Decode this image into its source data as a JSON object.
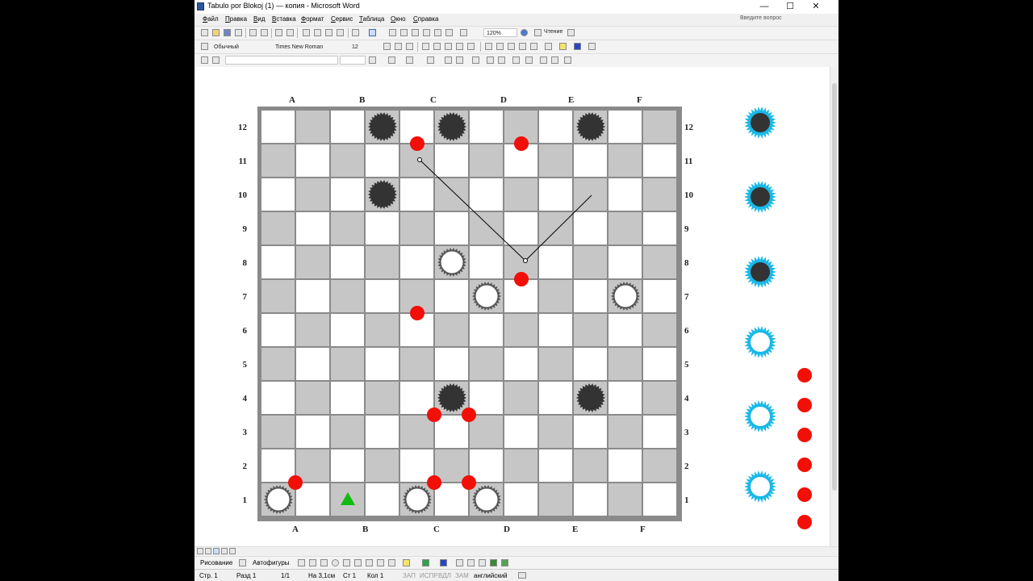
{
  "window": {
    "title": "Tabulo por Blokoj (1) — копия - Microsoft Word",
    "controls": {
      "minimize": "—",
      "maximize": "☐",
      "close": "✕"
    }
  },
  "menu": {
    "items": [
      "Файл",
      "Правка",
      "Вид",
      "Вставка",
      "Формат",
      "Сервис",
      "Таблица",
      "Окно",
      "Справка"
    ],
    "help_placeholder": "Введите вопрос"
  },
  "toolbar": {
    "zoom": "120%",
    "reading_label": "Чтение",
    "style": "Обычный",
    "font": "Times New Roman",
    "font_size": "12"
  },
  "board": {
    "columns": [
      "A",
      "B",
      "C",
      "D",
      "E",
      "F"
    ],
    "rows": [
      "12",
      "11",
      "10",
      "9",
      "8",
      "7",
      "6",
      "5",
      "4",
      "3",
      "2",
      "1"
    ],
    "colors": {
      "light": "#ffffff",
      "dark": "#c6c6c6",
      "frame": "#8a8a8a",
      "black_piece": "#333333",
      "red_marker": "#f10f07",
      "cyan_piece": "#18b8e8",
      "green_marker": "#12bb12"
    },
    "black_pieces": [
      {
        "col": 3,
        "row": 12
      },
      {
        "col": 5,
        "row": 12
      },
      {
        "col": 9,
        "row": 12
      },
      {
        "col": 3,
        "row": 10
      },
      {
        "col": 5,
        "row": 4
      },
      {
        "col": 9,
        "row": 4
      }
    ],
    "white_pieces": [
      {
        "col": 5,
        "row": 8
      },
      {
        "col": 6,
        "row": 7
      },
      {
        "col": 10,
        "row": 7
      },
      {
        "col": 0,
        "row": 1
      },
      {
        "col": 4,
        "row": 1
      },
      {
        "col": 6,
        "row": 1
      }
    ],
    "red_markers": [
      {
        "col": 4,
        "row": 11.5
      },
      {
        "col": 7,
        "row": 11.5
      },
      {
        "col": 7,
        "row": 7.5
      },
      {
        "col": 4,
        "row": 6.5
      },
      {
        "col": 4.5,
        "row": 3.5
      },
      {
        "col": 5.5,
        "row": 3.5
      },
      {
        "col": 0.5,
        "row": 1.5
      },
      {
        "col": 4.5,
        "row": 1.5
      },
      {
        "col": 5.5,
        "row": 1.5
      }
    ],
    "green_marker": {
      "col": 2,
      "row": 1
    }
  },
  "side_panel": {
    "cyan_pieces": [
      "dark",
      "dark",
      "dark",
      "light",
      "light",
      "light"
    ],
    "red_marker_count": 6
  },
  "status": {
    "page": "Стр. 1",
    "section": "Разд 1",
    "pages": "1/1",
    "position": "На 3,1см",
    "line": "Ст 1",
    "column": "Кол 1",
    "modes": [
      "ЗАП",
      "ИСПР",
      "ВДЛ",
      "ЗАМ"
    ],
    "language": "английский"
  },
  "drawing": {
    "draw_label": "Рисование",
    "autoshapes_label": "Автофигуры"
  }
}
